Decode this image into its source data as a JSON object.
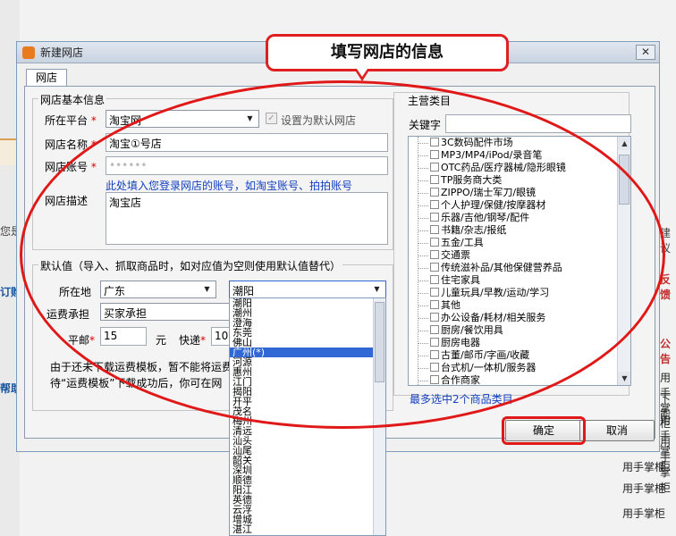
{
  "background": {
    "left_text_1": "您是",
    "left_text_2": "订购",
    "left_text_3": "帮助",
    "right_text_1": "建议",
    "right_red": "反馈",
    "right_red_2": "公告",
    "right_links": [
      "用手掌柜",
      "下能",
      "用手掌柜",
      "用手掌柜",
      "用手掌柜",
      "用手掌柜",
      "用手掌柜"
    ]
  },
  "dialog": {
    "title": "新建网店",
    "close": "✕",
    "tab": "网店"
  },
  "basic_group": {
    "title": "网店基本信息",
    "platform_label": "所在平台",
    "platform_value": "淘宝网",
    "default_checkbox_label": "设置为默认网店",
    "shop_name_label": "网店名称",
    "shop_name_value": "淘宝①号店",
    "account_label": "网店账号",
    "account_value": "••••••",
    "account_hint": "此处填入您登录网店的账号，如淘宝账号、拍拍账号",
    "desc_label": "网店描述",
    "desc_value": "淘宝店"
  },
  "defaults_group": {
    "title": "默认值（导入、抓取商品时，如对应值为空则使用默认值替代）",
    "location_label": "所在地",
    "province_value": "广东",
    "city_value": "潮阳",
    "freight_label": "运费承担",
    "freight_value": "买家承担",
    "mail_label": "平邮",
    "mail_value": "15",
    "yuan": "元",
    "express_label": "快递",
    "express_value": "10",
    "note_1": "由于还未下载运费模板，暂不能将运费",
    "note_2": "待“运费模板”下载成功后，你可在网"
  },
  "city_dropdown": [
    "潮阳",
    "潮州",
    "澄海",
    "东莞",
    "佛山",
    "广州(*)",
    "河源",
    "惠州",
    "江门",
    "揭阳",
    "开平",
    "茂名",
    "梅州",
    "清远",
    "汕头",
    "汕尾",
    "韶关",
    "深圳",
    "顺德",
    "阳江",
    "英德",
    "云浮",
    "增城",
    "湛江"
  ],
  "city_selected_index": 5,
  "category": {
    "title": "主营类目",
    "keyword_label": "关键字",
    "items": [
      "3C数码配件市场",
      "MP3/MP4/iPod/录音笔",
      "OTC药品/医疗器械/隐形眼镜",
      "TP服务商大类",
      "ZIPPO/瑞士军刀/眼镜",
      "个人护理/保健/按摩器材",
      "乐器/吉他/钢琴/配件",
      "书籍/杂志/报纸",
      "五金/工具",
      "交通票",
      "传统滋补品/其他保健营养品",
      "住宅家具",
      "儿童玩具/早教/运动/学习",
      "其他",
      "办公设备/耗材/相关服务",
      "厨房/餐饮用具",
      "厨房电器",
      "古董/邮币/字画/收藏",
      "台式机/一体机/服务器",
      "合作商家"
    ],
    "footer": "最多选中2个商品类目"
  },
  "buttons": {
    "ok": "确定",
    "cancel": "取消"
  },
  "callout": "填写网店的信息",
  "colors": {
    "annotation": "#e01818",
    "hint_blue": "#1440c0",
    "selected": "#3168d5"
  }
}
